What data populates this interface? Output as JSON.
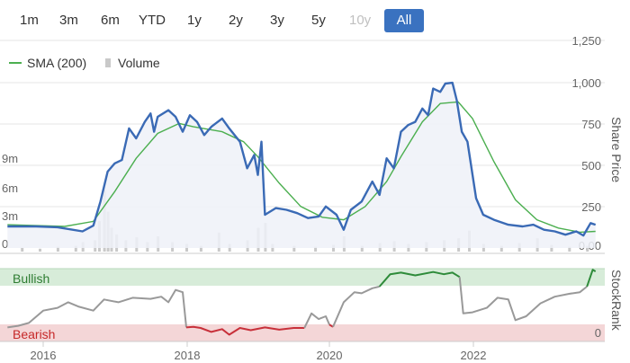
{
  "range_buttons": [
    {
      "label": "1m",
      "state": "normal"
    },
    {
      "label": "3m",
      "state": "normal"
    },
    {
      "label": "6m",
      "state": "normal"
    },
    {
      "label": "YTD",
      "state": "normal"
    },
    {
      "label": "1y",
      "state": "normal"
    },
    {
      "label": "2y",
      "state": "normal"
    },
    {
      "label": "3y",
      "state": "normal"
    },
    {
      "label": "5y",
      "state": "normal"
    },
    {
      "label": "10y",
      "state": "disabled"
    },
    {
      "label": "All",
      "state": "active"
    }
  ],
  "legend": {
    "sma_label": "SMA (200)",
    "volume_label": "Volume"
  },
  "axes": {
    "price_title": "Share Price",
    "stockrank_title": "StockRank",
    "price_ticks": [
      "1,250",
      "1,000",
      "750",
      "500",
      "250",
      "0.00"
    ],
    "volume_ticks": [
      "9m",
      "6m",
      "3m",
      "0"
    ],
    "stockrank_zero": "0",
    "x_ticks": [
      "2016",
      "2018",
      "2020",
      "2022"
    ]
  },
  "zones": {
    "bullish": "Bullish",
    "bearish": "Bearish"
  },
  "colors": {
    "price_line": "#3a6ab5",
    "price_fill": "#eef1f8",
    "sma_line": "#4caf50",
    "volume_bar": "#c9c9c9",
    "bullish_band": "#d7ecd9",
    "bearish_band": "#f4d6d7",
    "rank_neutral": "#999999",
    "rank_bullish": "#2e8b3a",
    "rank_bearish": "#c8303a",
    "active_button": "#3a72c0"
  },
  "chart_data": [
    {
      "type": "line",
      "x_unit": "year",
      "x_range": [
        2015.5,
        2023.75
      ],
      "y_range": [
        0,
        1250
      ],
      "series": [
        {
          "name": "Share Price",
          "points": [
            [
              2015.5,
              130
            ],
            [
              2015.9,
              130
            ],
            [
              2016.2,
              125
            ],
            [
              2016.55,
              100
            ],
            [
              2016.7,
              135
            ],
            [
              2016.8,
              280
            ],
            [
              2016.9,
              460
            ],
            [
              2017.0,
              510
            ],
            [
              2017.1,
              530
            ],
            [
              2017.2,
              720
            ],
            [
              2017.3,
              660
            ],
            [
              2017.42,
              760
            ],
            [
              2017.5,
              810
            ],
            [
              2017.55,
              700
            ],
            [
              2017.6,
              790
            ],
            [
              2017.75,
              830
            ],
            [
              2017.85,
              790
            ],
            [
              2017.95,
              700
            ],
            [
              2018.05,
              800
            ],
            [
              2018.15,
              760
            ],
            [
              2018.25,
              680
            ],
            [
              2018.35,
              730
            ],
            [
              2018.5,
              780
            ],
            [
              2018.6,
              720
            ],
            [
              2018.75,
              640
            ],
            [
              2018.85,
              480
            ],
            [
              2018.95,
              560
            ],
            [
              2019.0,
              440
            ],
            [
              2019.05,
              640
            ],
            [
              2019.1,
              200
            ],
            [
              2019.25,
              240
            ],
            [
              2019.4,
              230
            ],
            [
              2019.55,
              210
            ],
            [
              2019.7,
              180
            ],
            [
              2019.85,
              190
            ],
            [
              2019.95,
              250
            ],
            [
              2020.1,
              200
            ],
            [
              2020.2,
              110
            ],
            [
              2020.3,
              230
            ],
            [
              2020.45,
              280
            ],
            [
              2020.6,
              400
            ],
            [
              2020.7,
              320
            ],
            [
              2020.8,
              540
            ],
            [
              2020.9,
              480
            ],
            [
              2021.0,
              700
            ],
            [
              2021.1,
              740
            ],
            [
              2021.2,
              760
            ],
            [
              2021.3,
              840
            ],
            [
              2021.38,
              800
            ],
            [
              2021.45,
              960
            ],
            [
              2021.55,
              940
            ],
            [
              2021.62,
              990
            ],
            [
              2021.72,
              995
            ],
            [
              2021.78,
              890
            ],
            [
              2021.85,
              700
            ],
            [
              2021.93,
              640
            ],
            [
              2022.05,
              300
            ],
            [
              2022.15,
              200
            ],
            [
              2022.3,
              170
            ],
            [
              2022.5,
              140
            ],
            [
              2022.7,
              130
            ],
            [
              2022.85,
              140
            ],
            [
              2023.0,
              110
            ],
            [
              2023.15,
              100
            ],
            [
              2023.3,
              80
            ],
            [
              2023.45,
              100
            ],
            [
              2023.55,
              75
            ],
            [
              2023.65,
              150
            ],
            [
              2023.72,
              140
            ]
          ]
        },
        {
          "name": "SMA (200)",
          "points": [
            [
              2015.5,
              140
            ],
            [
              2016.3,
              130
            ],
            [
              2016.7,
              160
            ],
            [
              2017.0,
              340
            ],
            [
              2017.3,
              540
            ],
            [
              2017.6,
              690
            ],
            [
              2017.9,
              750
            ],
            [
              2018.1,
              730
            ],
            [
              2018.5,
              700
            ],
            [
              2018.8,
              640
            ],
            [
              2019.0,
              550
            ],
            [
              2019.3,
              390
            ],
            [
              2019.6,
              250
            ],
            [
              2019.9,
              185
            ],
            [
              2020.2,
              170
            ],
            [
              2020.5,
              250
            ],
            [
              2020.8,
              400
            ],
            [
              2021.0,
              550
            ],
            [
              2021.3,
              760
            ],
            [
              2021.55,
              870
            ],
            [
              2021.8,
              880
            ],
            [
              2022.0,
              780
            ],
            [
              2022.3,
              520
            ],
            [
              2022.6,
              290
            ],
            [
              2022.9,
              170
            ],
            [
              2023.2,
              120
            ],
            [
              2023.5,
              95
            ],
            [
              2023.72,
              100
            ]
          ]
        }
      ]
    },
    {
      "type": "bar",
      "name": "Volume",
      "x_unit": "year",
      "y_range": [
        0,
        12
      ],
      "y_unit": "m",
      "bars": [
        [
          2015.7,
          0.4
        ],
        [
          2015.95,
          0.3
        ],
        [
          2016.2,
          0.5
        ],
        [
          2016.45,
          0.6
        ],
        [
          2016.55,
          1.0
        ],
        [
          2016.72,
          1.2
        ],
        [
          2016.78,
          3.2
        ],
        [
          2016.85,
          6.5
        ],
        [
          2016.9,
          4.2
        ],
        [
          2016.95,
          2.5
        ],
        [
          2017.02,
          1.8
        ],
        [
          2017.15,
          1.2
        ],
        [
          2017.3,
          1.5
        ],
        [
          2017.45,
          1.0
        ],
        [
          2017.6,
          1.6
        ],
        [
          2017.8,
          1.0
        ],
        [
          2018.0,
          0.8
        ],
        [
          2018.2,
          0.6
        ],
        [
          2018.45,
          2.0
        ],
        [
          2018.6,
          0.8
        ],
        [
          2018.85,
          1.2
        ],
        [
          2019.0,
          2.5
        ],
        [
          2019.1,
          3.0
        ],
        [
          2019.2,
          0.8
        ],
        [
          2019.5,
          0.6
        ],
        [
          2019.8,
          0.5
        ],
        [
          2020.05,
          0.7
        ],
        [
          2020.2,
          1.6
        ],
        [
          2020.45,
          0.6
        ],
        [
          2020.7,
          0.9
        ],
        [
          2020.9,
          1.1
        ],
        [
          2021.1,
          0.8
        ],
        [
          2021.35,
          1.0
        ],
        [
          2021.6,
          1.2
        ],
        [
          2021.8,
          1.4
        ],
        [
          2021.95,
          2.2
        ],
        [
          2022.15,
          0.8
        ],
        [
          2022.4,
          0.6
        ],
        [
          2022.65,
          0.9
        ],
        [
          2022.9,
          1.4
        ],
        [
          2023.1,
          0.7
        ],
        [
          2023.35,
          0.5
        ],
        [
          2023.6,
          0.6
        ]
      ]
    },
    {
      "type": "line",
      "name": "StockRank",
      "x_unit": "year",
      "y_range": [
        0,
        100
      ],
      "segments": [
        {
          "zone": "neutral",
          "points": [
            [
              2015.5,
              25
            ],
            [
              2015.65,
              28
            ],
            [
              2015.8,
              33
            ],
            [
              2016.0,
              55
            ],
            [
              2016.2,
              60
            ],
            [
              2016.35,
              70
            ],
            [
              2016.5,
              62
            ],
            [
              2016.7,
              55
            ],
            [
              2016.85,
              75
            ],
            [
              2017.05,
              70
            ],
            [
              2017.25,
              78
            ],
            [
              2017.5,
              76
            ],
            [
              2017.65,
              80
            ],
            [
              2017.75,
              70
            ],
            [
              2017.85,
              92
            ],
            [
              2017.95,
              88
            ],
            [
              2018.0,
              25
            ]
          ]
        },
        {
          "zone": "bearish",
          "points": [
            [
              2018.0,
              25
            ],
            [
              2018.1,
              26
            ],
            [
              2018.2,
              24
            ],
            [
              2018.35,
              17
            ],
            [
              2018.5,
              22
            ],
            [
              2018.6,
              12
            ],
            [
              2018.75,
              24
            ],
            [
              2018.9,
              20
            ],
            [
              2019.1,
              25
            ],
            [
              2019.3,
              21
            ],
            [
              2019.5,
              24
            ],
            [
              2019.65,
              24
            ]
          ]
        },
        {
          "zone": "neutral",
          "points": [
            [
              2019.65,
              24
            ],
            [
              2019.75,
              50
            ],
            [
              2019.85,
              40
            ],
            [
              2019.95,
              45
            ],
            [
              2020.0,
              30
            ]
          ]
        },
        {
          "zone": "bearish",
          "points": [
            [
              2020.0,
              30
            ],
            [
              2020.05,
              26
            ]
          ]
        },
        {
          "zone": "neutral",
          "points": [
            [
              2020.05,
              26
            ],
            [
              2020.2,
              70
            ],
            [
              2020.35,
              88
            ],
            [
              2020.45,
              86
            ],
            [
              2020.6,
              95
            ],
            [
              2020.7,
              98
            ]
          ]
        },
        {
          "zone": "bullish",
          "points": [
            [
              2020.7,
              98
            ],
            [
              2020.85,
              120
            ],
            [
              2021.0,
              123
            ],
            [
              2021.2,
              118
            ],
            [
              2021.45,
              124
            ],
            [
              2021.6,
              120
            ],
            [
              2021.72,
              123
            ],
            [
              2021.82,
              115
            ]
          ]
        },
        {
          "zone": "neutral",
          "points": [
            [
              2021.82,
              115
            ],
            [
              2021.87,
              50
            ],
            [
              2022.0,
              52
            ],
            [
              2022.2,
              60
            ],
            [
              2022.35,
              78
            ],
            [
              2022.5,
              75
            ],
            [
              2022.6,
              38
            ],
            [
              2022.75,
              45
            ],
            [
              2022.95,
              68
            ],
            [
              2023.15,
              80
            ],
            [
              2023.35,
              85
            ],
            [
              2023.5,
              88
            ],
            [
              2023.6,
              98
            ]
          ]
        },
        {
          "zone": "bullish",
          "points": [
            [
              2023.6,
              98
            ],
            [
              2023.68,
              128
            ],
            [
              2023.72,
              125
            ]
          ]
        }
      ]
    }
  ]
}
